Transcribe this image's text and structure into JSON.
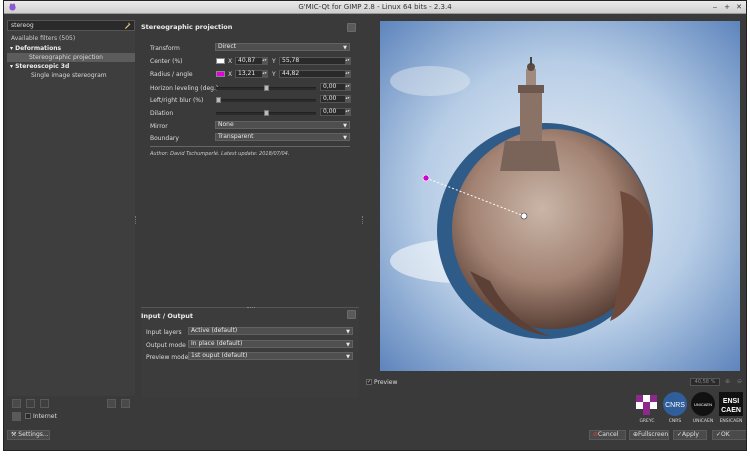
{
  "window": {
    "title": "G'MIC-Qt for GIMP 2.8 - Linux 64 bits - 2.3.4"
  },
  "left": {
    "search_value": "stereog",
    "available": "Available filters (505)",
    "tree": [
      {
        "label": "Deformations",
        "kind": "cat"
      },
      {
        "label": "Stereographic projection",
        "kind": "item",
        "selected": true
      },
      {
        "label": "Stereoscopic 3d",
        "kind": "cat"
      },
      {
        "label": "Single image stereogram",
        "kind": "item"
      }
    ],
    "internet_label": "Internet",
    "settings_label": "Settings..."
  },
  "filter": {
    "title": "Stereographic projection",
    "transform_label": "Transform",
    "transform_value": "Direct",
    "center_label": "Center (%)",
    "center_x": "40,87",
    "center_y": "55,78",
    "radius_label": "Radius / angle",
    "radius_x": "13,21",
    "radius_y": "44,82",
    "horizon_label": "Horizon leveling (deg.)",
    "horizon_value": "0,00",
    "blur_label": "Left/right blur (%)",
    "blur_value": "0,00",
    "dilation_label": "Dilation",
    "dilation_value": "0,00",
    "mirror_label": "Mirror",
    "mirror_value": "None",
    "boundary_label": "Boundary",
    "boundary_value": "Transparent",
    "x_label": "X",
    "y_label": "Y",
    "author": "Author: David Tschumperlé. Latest update: 2018/07/04.",
    "colors": {
      "center": "#ffffff",
      "radius": "#e000e0"
    }
  },
  "io": {
    "title": "Input / Output",
    "input_label": "Input layers",
    "input_value": "Active (default)",
    "output_label": "Output mode",
    "output_value": "In place (default)",
    "preview_label": "Preview mode",
    "preview_value": "1st ouput (default)"
  },
  "preview": {
    "checkbox_label": "Preview",
    "zoom": "40,58 %"
  },
  "logos": [
    {
      "caption": "GREYC"
    },
    {
      "caption": "CNRS",
      "text": "CNRS"
    },
    {
      "caption": "UNICAEN",
      "text": "UNICAEN"
    },
    {
      "caption": "ENSICAEN",
      "text": "ENSI CAEN"
    }
  ],
  "buttons": {
    "cancel": "Cancel",
    "fullscreen": "Fullscreen",
    "apply": "Apply",
    "ok": "OK"
  }
}
